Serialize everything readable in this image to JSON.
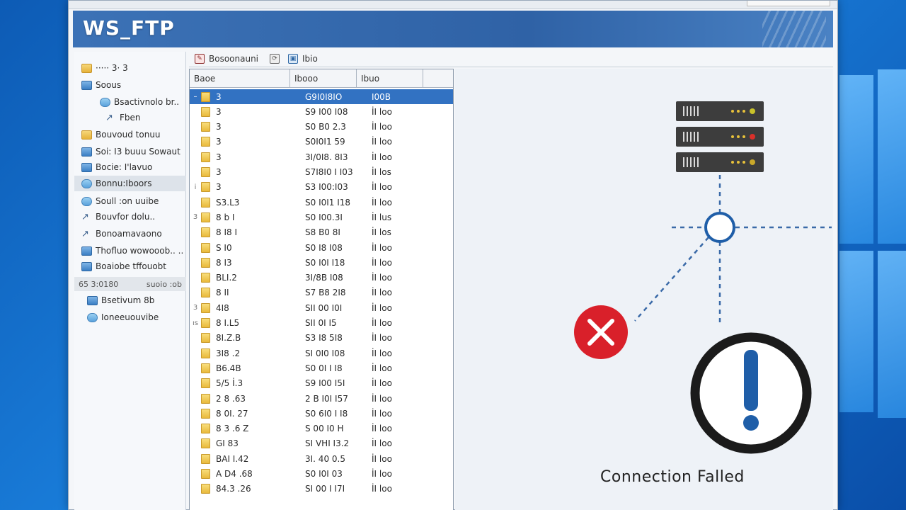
{
  "window": {
    "title": "",
    "brand": "WS_FTP"
  },
  "tree": {
    "items": [
      {
        "label": "····· 3· 3",
        "icon": "folder-icon"
      },
      {
        "label": "Soous",
        "icon": "drive-icon"
      },
      {
        "label": "Bsactivnolo br..",
        "icon": "network-icon"
      },
      {
        "label": "Fben",
        "icon": "link-icon"
      },
      {
        "label": "Bouvoud tonuu",
        "icon": "folder-icon"
      },
      {
        "label": "Soi: I3 buuu Sowaut",
        "icon": "drive-icon"
      },
      {
        "label": "Bocie: I'lavuo",
        "icon": "drive-icon"
      },
      {
        "label": "Bonnu:Iboors",
        "icon": "network-icon"
      },
      {
        "label": "Soull :on uuibe",
        "icon": "network-icon"
      },
      {
        "label": "Bouvfor dolu..",
        "icon": "link-icon"
      },
      {
        "label": "Bonoamavaono",
        "icon": "link-icon"
      },
      {
        "label": "Thofluo wowooob.. ..",
        "icon": "drive-icon"
      },
      {
        "label": "Boaiobe tffouobt",
        "icon": "drive-icon"
      }
    ],
    "section": {
      "left": "65 3:0180",
      "right": "suoio :ob"
    },
    "bottom_items": [
      {
        "label": "Bsetivum 8b",
        "icon": "drive-icon"
      },
      {
        "label": "Ioneeuouvibe",
        "icon": "network-icon"
      }
    ]
  },
  "toolbar": {
    "btn1": "Bosoonauni",
    "btn2": "Ibio"
  },
  "filelist": {
    "headers": [
      "Baoe",
      "Ibooo",
      "Ibuo"
    ],
    "rows": [
      {
        "mark": "–",
        "name": "3",
        "date": "G9I0I8IO",
        "size": "I00B",
        "selected": true
      },
      {
        "mark": "",
        "name": "3",
        "date": "S9 I00 I08",
        "size": "İI loo",
        "selected": false
      },
      {
        "mark": "",
        "name": "3",
        "date": "S0 B0 2.3",
        "size": "İI loo",
        "selected": false
      },
      {
        "mark": "",
        "name": "3",
        "date": "S0I0I1 59",
        "size": "İI loo",
        "selected": false
      },
      {
        "mark": "",
        "name": "3",
        "date": "3I/0I8. 8I3",
        "size": "İI loo",
        "selected": false
      },
      {
        "mark": "",
        "name": "3",
        "date": "S7I8I0 I I03",
        "size": "İI los",
        "selected": false
      },
      {
        "mark": "i",
        "name": "3",
        "date": "S3 I00:I03",
        "size": "İI loo",
        "selected": false
      },
      {
        "mark": "",
        "name": "S3.L3",
        "date": "S0 I0I1 I18",
        "size": "İI loo",
        "selected": false
      },
      {
        "mark": "3",
        "name": "8 b I",
        "date": "S0 I00.3I",
        "size": "İI lus",
        "selected": false
      },
      {
        "mark": "",
        "name": "8 I8 I",
        "date": "S8 B0 8I",
        "size": "İI los",
        "selected": false
      },
      {
        "mark": "",
        "name": "S I0",
        "date": "S0 I8 I08",
        "size": "İI loo",
        "selected": false
      },
      {
        "mark": "",
        "name": "8 I3",
        "date": "S0 I0I I18",
        "size": "İI loo",
        "selected": false
      },
      {
        "mark": "",
        "name": "BLI.2",
        "date": "3I/8B I08",
        "size": "İI loo",
        "selected": false
      },
      {
        "mark": "",
        "name": "8 II",
        "date": "S7 B8 2I8",
        "size": "İI loo",
        "selected": false
      },
      {
        "mark": "3",
        "name": "4I8",
        "date": "SII 00 I0I",
        "size": "İI loo",
        "selected": false
      },
      {
        "mark": "ıs",
        "name": "8 I.L5",
        "date": "SII 0I I5",
        "size": "İI loo",
        "selected": false
      },
      {
        "mark": "",
        "name": "8I.Z.B",
        "date": "S3 I8 5I8",
        "size": "İI loo",
        "selected": false
      },
      {
        "mark": "",
        "name": "3I8 .2",
        "date": "SI 0I0 I08",
        "size": "İI loo",
        "selected": false
      },
      {
        "mark": "",
        "name": "B6.4B",
        "date": "S0 0I I I8",
        "size": "İI loo",
        "selected": false
      },
      {
        "mark": "",
        "name": "5/5 İ.3",
        "date": "S9 I00 I5I",
        "size": "İI loo",
        "selected": false
      },
      {
        "mark": "",
        "name": "2 8 .63",
        "date": "2 B I0I I57",
        "size": "İI loo",
        "selected": false
      },
      {
        "mark": "",
        "name": "8 0I. 27",
        "date": "S0 6I0 I I8",
        "size": "İI loo",
        "selected": false
      },
      {
        "mark": "",
        "name": "8 3 .6 Z",
        "date": "S 00 I0 H",
        "size": "İI loo",
        "selected": false
      },
      {
        "mark": "",
        "name": "GI 83",
        "date": "SI VHI I3.2",
        "size": "İI loo",
        "selected": false
      },
      {
        "mark": "",
        "name": "BAI I.42",
        "date": "3I. 40 0.5",
        "size": "İI loo",
        "selected": false
      },
      {
        "mark": "",
        "name": "A D4 .68",
        "date": "S0 I0I 03",
        "size": "İI loo",
        "selected": false
      },
      {
        "mark": "",
        "name": "84.3 .26",
        "date": "SI 00 I I7I",
        "size": "İI loo",
        "selected": false
      }
    ]
  },
  "status": {
    "message": "Connection Falled",
    "colors": {
      "error": "#d9202a",
      "alert_blue": "#1f5ea8",
      "ring": "#1b1b1b",
      "server_body": "#3d3d3d",
      "dash": "#3a6aa8"
    }
  }
}
